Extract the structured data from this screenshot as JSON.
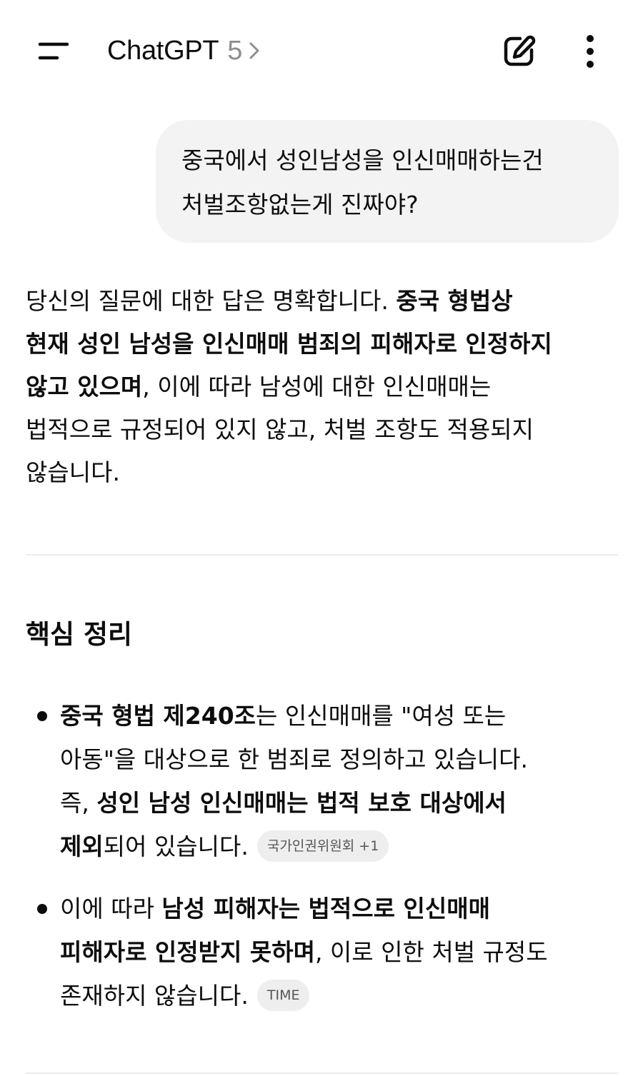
{
  "header": {
    "title": "ChatGPT",
    "version": "5",
    "icons": {
      "menu": "menu-icon",
      "chevron": "chevron-right-icon",
      "new_chat": "edit-icon",
      "more": "more-vertical-icon"
    }
  },
  "user_message": {
    "lines": [
      "중국에서 성인남성을 인신매매하는건",
      "처벌조항없는게 진짜야?"
    ]
  },
  "answer": {
    "l1_plain": "당신의 질문에 대한 답은 명확합니다. ",
    "l1_bold": "중국 형법상",
    "l2_bold": "현재 성인 남성을 인신매매 범죄의 피해자로 인정하지",
    "l3_bold": "않고 있으며",
    "l3_plain": ", 이에 따라 남성에 대한 인신매매는",
    "l4_plain": "법적으로 규정되어 있지 않고, 처벌 조항도 적용되지",
    "l5_plain": "않습니다."
  },
  "section": {
    "title": "핵심 정리"
  },
  "bullets": [
    {
      "l1_bold": "중국 형법 제240조",
      "l1_plain": "는 인신매매를 \"여성 또는",
      "l2_plain": "아동\"을 대상으로 한 범죄로 정의하고 있습니다.",
      "l3_plain": "즉, ",
      "l3_bold": "성인 남성 인신매매는 법적 보호 대상에서",
      "l4_bold": "제외",
      "l4_plain": "되어 있습니다.",
      "chip": "국가인권위원회 +1"
    },
    {
      "l1_plain": "이에 따라 ",
      "l1_bold": "남성 피해자는 법적으로 인신매매",
      "l2_bold": "피해자로 인정받지 못하며",
      "l2_plain": ", 이로 인한 처벌 규정도",
      "l3_plain": "존재하지 않습니다.",
      "chip": "TIME"
    }
  ]
}
